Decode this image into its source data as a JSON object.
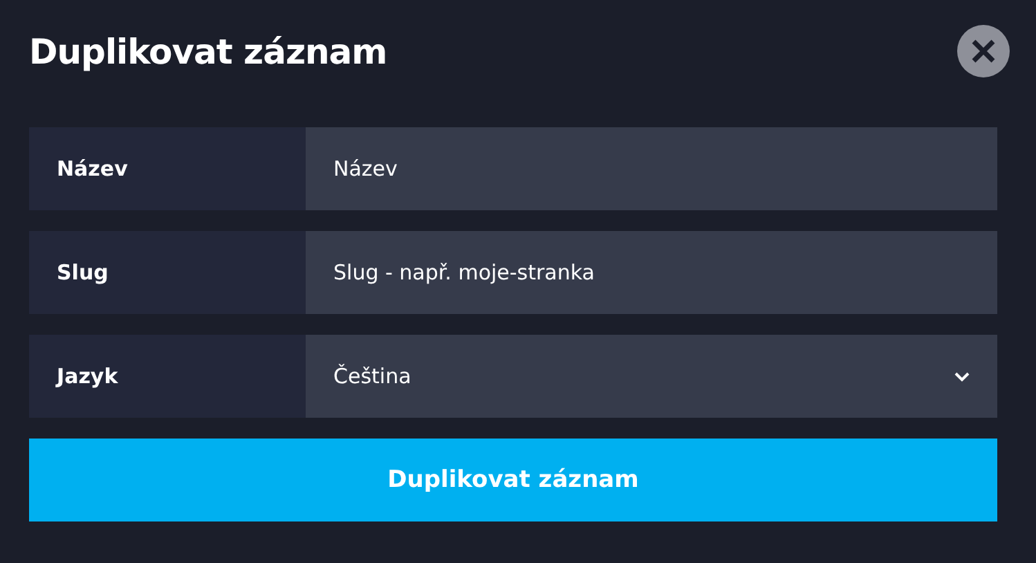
{
  "dialog": {
    "title": "Duplikovat záznam",
    "fields": [
      {
        "kind": "text",
        "label": "Název",
        "placeholder": "Název"
      },
      {
        "kind": "text",
        "label": "Slug",
        "placeholder": "Slug - např. moje-stranka"
      },
      {
        "kind": "select",
        "label": "Jazyk",
        "value": "Čeština"
      }
    ],
    "submit": "Duplikovat záznam"
  }
}
